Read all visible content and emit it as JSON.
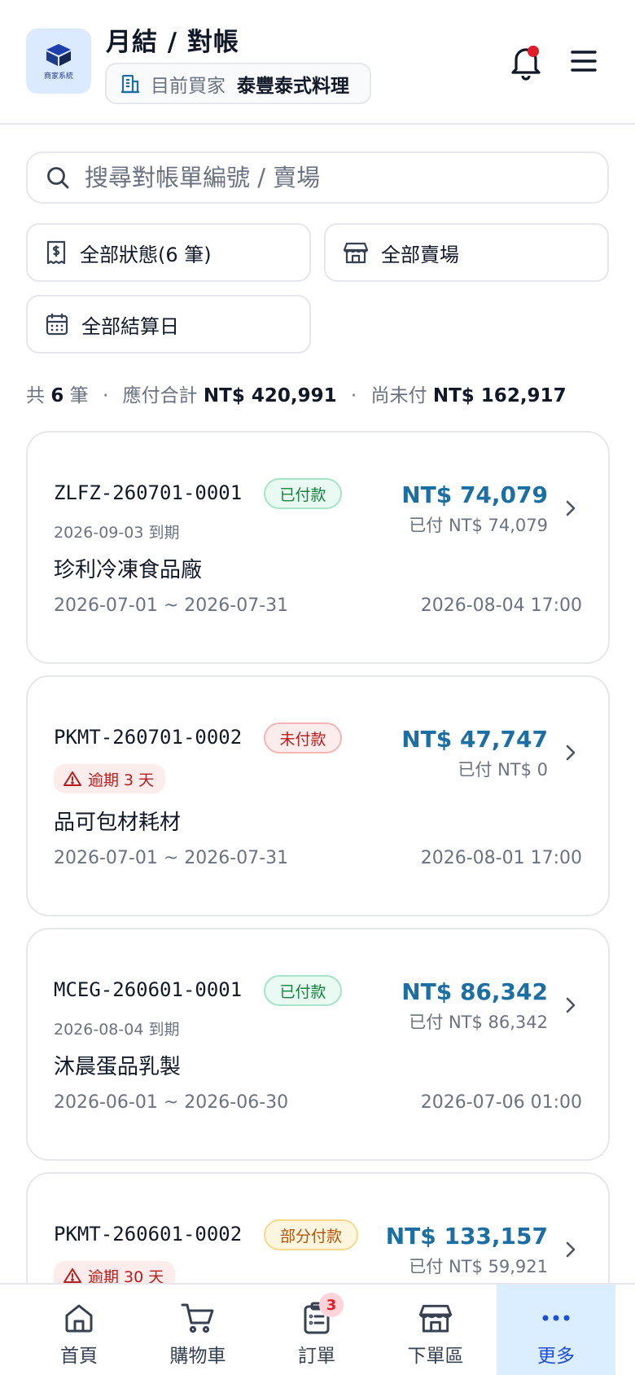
{
  "header": {
    "logo_caption": "商家系統",
    "title": "月結 / 對帳",
    "buyer_label": "目前買家",
    "buyer_name": "泰豐泰式料理"
  },
  "search": {
    "placeholder": "搜尋對帳單編號 / 賣場"
  },
  "filters": {
    "status": "全部狀態(6 筆)",
    "store": "全部賣場",
    "settle_day": "全部結算日"
  },
  "summary": {
    "count_prefix": "共",
    "count": "6",
    "count_unit": "筆",
    "payable_label": "應付合計",
    "payable_value": "NT$ 420,991",
    "unpaid_label": "尚未付",
    "unpaid_value": "NT$ 162,917",
    "separator": "·"
  },
  "statements": [
    {
      "code": "ZLFZ-260701-0001",
      "status": "已付款",
      "due": "2026-09-03 到期",
      "vendor": "珍利冷凍食品廠",
      "period": "2026-07-01 ~ 2026-07-31",
      "timestamp": "2026-08-04 17:00",
      "amount": "NT$ 74,079",
      "paid": "已付 NT$ 74,079"
    },
    {
      "code": "PKMT-260701-0002",
      "status": "未付款",
      "overdue": "逾期 3 天",
      "vendor": "品可包材耗材",
      "period": "2026-07-01 ~ 2026-07-31",
      "timestamp": "2026-08-01 17:00",
      "amount": "NT$ 47,747",
      "paid": "已付 NT$ 0"
    },
    {
      "code": "MCEG-260601-0001",
      "status": "已付款",
      "due": "2026-08-04 到期",
      "vendor": "沐晨蛋品乳製",
      "period": "2026-06-01 ~ 2026-06-30",
      "timestamp": "2026-07-06 01:00",
      "amount": "NT$ 86,342",
      "paid": "已付 NT$ 86,342"
    },
    {
      "code": "PKMT-260601-0002",
      "status": "部分付款",
      "overdue": "逾期 30 天",
      "amount": "NT$ 133,157",
      "paid": "已付 NT$ 59,921"
    }
  ],
  "nav": {
    "home": "首頁",
    "cart": "購物車",
    "orders": "訂單",
    "orders_badge": "3",
    "order_area": "下單區",
    "more": "更多"
  },
  "colors": {
    "accent": "#1d6fa3",
    "active_nav_bg": "#dbeeff",
    "notification_dot": "#e11d2a"
  },
  "icons": [
    "logo-box-icon",
    "building-icon",
    "bell-icon",
    "menu-icon",
    "search-icon",
    "receipt-icon",
    "store-icon",
    "calendar-icon",
    "warning-icon",
    "chevron-right-icon",
    "home-icon",
    "cart-icon",
    "clipboard-icon",
    "more-icon"
  ]
}
